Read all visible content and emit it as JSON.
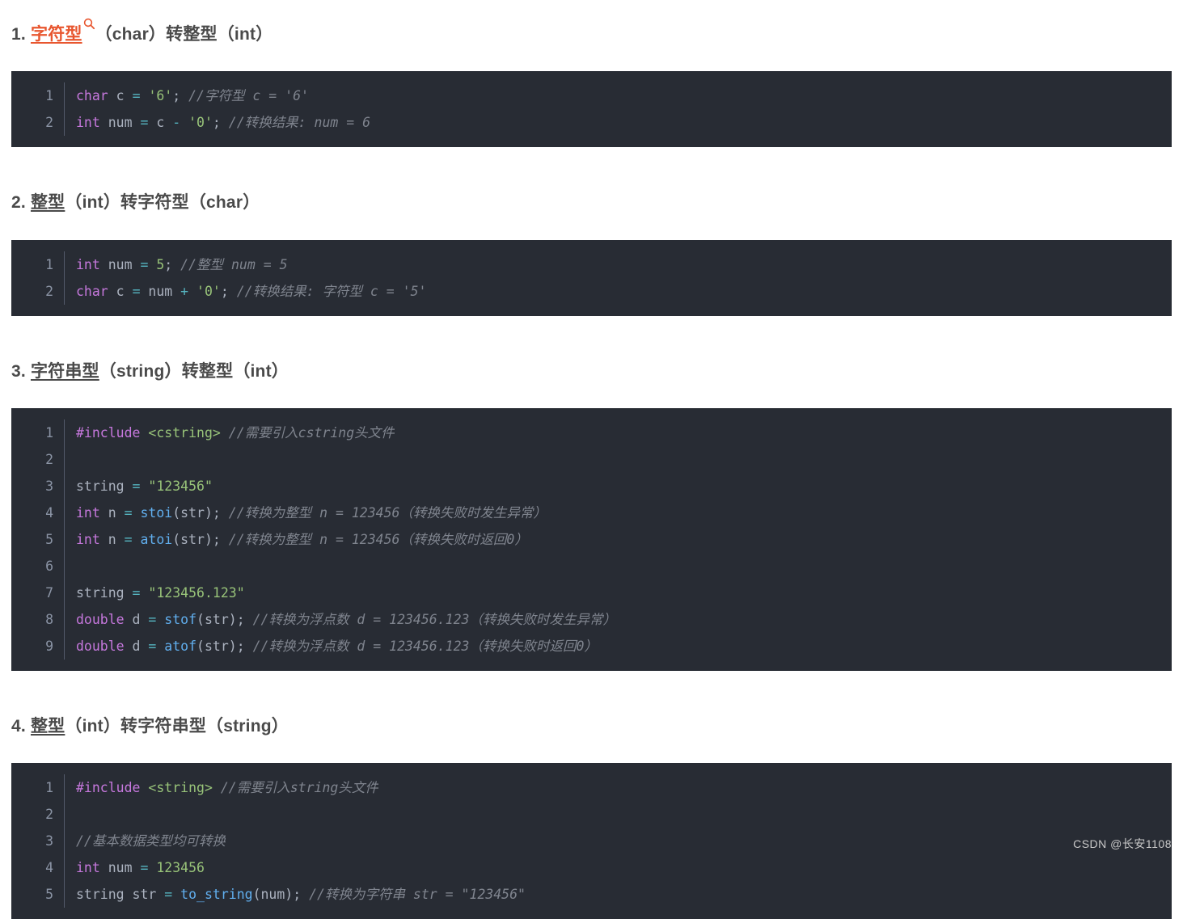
{
  "sections": [
    {
      "heading": {
        "number": "1.",
        "highlight": "字符型",
        "icon": "search-icon",
        "rest": "（char）转整型（int）"
      },
      "code": {
        "lines": [
          {
            "no": "1",
            "tokens": [
              {
                "t": "kw",
                "v": "char"
              },
              {
                "t": "var",
                "v": " c "
              },
              {
                "t": "op",
                "v": "="
              },
              {
                "t": "var",
                "v": " "
              },
              {
                "t": "str",
                "v": "'6'"
              },
              {
                "t": "punc",
                "v": ";"
              },
              {
                "t": "var",
                "v": " "
              },
              {
                "t": "com",
                "v": "//字符型 c = '6'"
              }
            ]
          },
          {
            "no": "2",
            "tokens": [
              {
                "t": "kw",
                "v": "int"
              },
              {
                "t": "var",
                "v": " num "
              },
              {
                "t": "op",
                "v": "="
              },
              {
                "t": "var",
                "v": " c "
              },
              {
                "t": "op",
                "v": "-"
              },
              {
                "t": "var",
                "v": " "
              },
              {
                "t": "str",
                "v": "'0'"
              },
              {
                "t": "punc",
                "v": ";"
              },
              {
                "t": "var",
                "v": " "
              },
              {
                "t": "com",
                "v": "//转换结果: num = 6"
              }
            ]
          }
        ]
      }
    },
    {
      "heading": {
        "number": "2.",
        "highlight": "",
        "icon": "",
        "rest": "整型（int）转字符型（char）",
        "underline_word": "整型"
      },
      "code": {
        "lines": [
          {
            "no": "1",
            "tokens": [
              {
                "t": "kw",
                "v": "int"
              },
              {
                "t": "var",
                "v": " num "
              },
              {
                "t": "op",
                "v": "="
              },
              {
                "t": "var",
                "v": " "
              },
              {
                "t": "num",
                "v": "5"
              },
              {
                "t": "punc",
                "v": ";"
              },
              {
                "t": "var",
                "v": " "
              },
              {
                "t": "com",
                "v": "//整型 num = 5"
              }
            ]
          },
          {
            "no": "2",
            "tokens": [
              {
                "t": "kw",
                "v": "char"
              },
              {
                "t": "var",
                "v": " c "
              },
              {
                "t": "op",
                "v": "="
              },
              {
                "t": "var",
                "v": " num "
              },
              {
                "t": "op",
                "v": "+"
              },
              {
                "t": "var",
                "v": " "
              },
              {
                "t": "str",
                "v": "'0'"
              },
              {
                "t": "punc",
                "v": ";"
              },
              {
                "t": "var",
                "v": " "
              },
              {
                "t": "com",
                "v": "//转换结果: 字符型 c = '5'"
              }
            ]
          }
        ]
      }
    },
    {
      "heading": {
        "number": "3.",
        "highlight": "",
        "icon": "",
        "rest": "字符串型（string）转整型（int）",
        "underline_word": "字符串型"
      },
      "code": {
        "lines": [
          {
            "no": "1",
            "tokens": [
              {
                "t": "pre",
                "v": "#include"
              },
              {
                "t": "var",
                "v": " "
              },
              {
                "t": "inc",
                "v": "<cstring>"
              },
              {
                "t": "var",
                "v": " "
              },
              {
                "t": "com",
                "v": "//需要引入cstring头文件"
              }
            ]
          },
          {
            "no": "2",
            "tokens": []
          },
          {
            "no": "3",
            "tokens": [
              {
                "t": "var",
                "v": "string "
              },
              {
                "t": "op",
                "v": "="
              },
              {
                "t": "var",
                "v": " "
              },
              {
                "t": "str",
                "v": "\"123456\""
              }
            ]
          },
          {
            "no": "4",
            "tokens": [
              {
                "t": "kw",
                "v": "int"
              },
              {
                "t": "var",
                "v": " n "
              },
              {
                "t": "op",
                "v": "="
              },
              {
                "t": "var",
                "v": " "
              },
              {
                "t": "fn",
                "v": "stoi"
              },
              {
                "t": "punc",
                "v": "(str);"
              },
              {
                "t": "var",
                "v": " "
              },
              {
                "t": "com",
                "v": "//转换为整型 n = 123456（转换失败时发生异常）"
              }
            ]
          },
          {
            "no": "5",
            "tokens": [
              {
                "t": "kw",
                "v": "int"
              },
              {
                "t": "var",
                "v": " n "
              },
              {
                "t": "op",
                "v": "="
              },
              {
                "t": "var",
                "v": " "
              },
              {
                "t": "fn",
                "v": "atoi"
              },
              {
                "t": "punc",
                "v": "(str);"
              },
              {
                "t": "var",
                "v": " "
              },
              {
                "t": "com",
                "v": "//转换为整型 n = 123456（转换失败时返回0）"
              }
            ]
          },
          {
            "no": "6",
            "tokens": []
          },
          {
            "no": "7",
            "tokens": [
              {
                "t": "var",
                "v": "string "
              },
              {
                "t": "op",
                "v": "="
              },
              {
                "t": "var",
                "v": " "
              },
              {
                "t": "str",
                "v": "\"123456.123\""
              }
            ]
          },
          {
            "no": "8",
            "tokens": [
              {
                "t": "kw",
                "v": "double"
              },
              {
                "t": "var",
                "v": " d "
              },
              {
                "t": "op",
                "v": "="
              },
              {
                "t": "var",
                "v": " "
              },
              {
                "t": "fn",
                "v": "stof"
              },
              {
                "t": "punc",
                "v": "(str);"
              },
              {
                "t": "var",
                "v": " "
              },
              {
                "t": "com",
                "v": "//转换为浮点数 d = 123456.123（转换失败时发生异常）"
              }
            ]
          },
          {
            "no": "9",
            "tokens": [
              {
                "t": "kw",
                "v": "double"
              },
              {
                "t": "var",
                "v": " d "
              },
              {
                "t": "op",
                "v": "="
              },
              {
                "t": "var",
                "v": " "
              },
              {
                "t": "fn",
                "v": "atof"
              },
              {
                "t": "punc",
                "v": "(str);"
              },
              {
                "t": "var",
                "v": " "
              },
              {
                "t": "com",
                "v": "//转换为浮点数 d = 123456.123（转换失败时返回0）"
              }
            ]
          }
        ]
      }
    },
    {
      "heading": {
        "number": "4.",
        "highlight": "",
        "icon": "",
        "rest": "整型（int）转字符串型（string）",
        "underline_word": "整型"
      },
      "code": {
        "lines": [
          {
            "no": "1",
            "tokens": [
              {
                "t": "pre",
                "v": "#include"
              },
              {
                "t": "var",
                "v": " "
              },
              {
                "t": "inc",
                "v": "<string>"
              },
              {
                "t": "var",
                "v": " "
              },
              {
                "t": "com",
                "v": "//需要引入string头文件"
              }
            ]
          },
          {
            "no": "2",
            "tokens": []
          },
          {
            "no": "3",
            "tokens": [
              {
                "t": "com",
                "v": "//基本数据类型均可转换"
              }
            ]
          },
          {
            "no": "4",
            "tokens": [
              {
                "t": "kw",
                "v": "int"
              },
              {
                "t": "var",
                "v": " num "
              },
              {
                "t": "op",
                "v": "="
              },
              {
                "t": "var",
                "v": " "
              },
              {
                "t": "num",
                "v": "123456"
              }
            ]
          },
          {
            "no": "5",
            "tokens": [
              {
                "t": "var",
                "v": "string str "
              },
              {
                "t": "op",
                "v": "="
              },
              {
                "t": "var",
                "v": " "
              },
              {
                "t": "fn",
                "v": "to_string"
              },
              {
                "t": "punc",
                "v": "(num);"
              },
              {
                "t": "var",
                "v": " "
              },
              {
                "t": "com",
                "v": "//转换为字符串 str = \"123456\""
              }
            ]
          }
        ]
      }
    }
  ],
  "watermark": "CSDN @长安1108",
  "colors": {
    "code_bg": "#282c34",
    "keyword": "#c678dd",
    "string": "#98c379",
    "comment": "#7f848e",
    "function": "#61afef",
    "operator": "#56b6c2",
    "heading": "#4a4a4a",
    "highlight": "#e8562f"
  }
}
